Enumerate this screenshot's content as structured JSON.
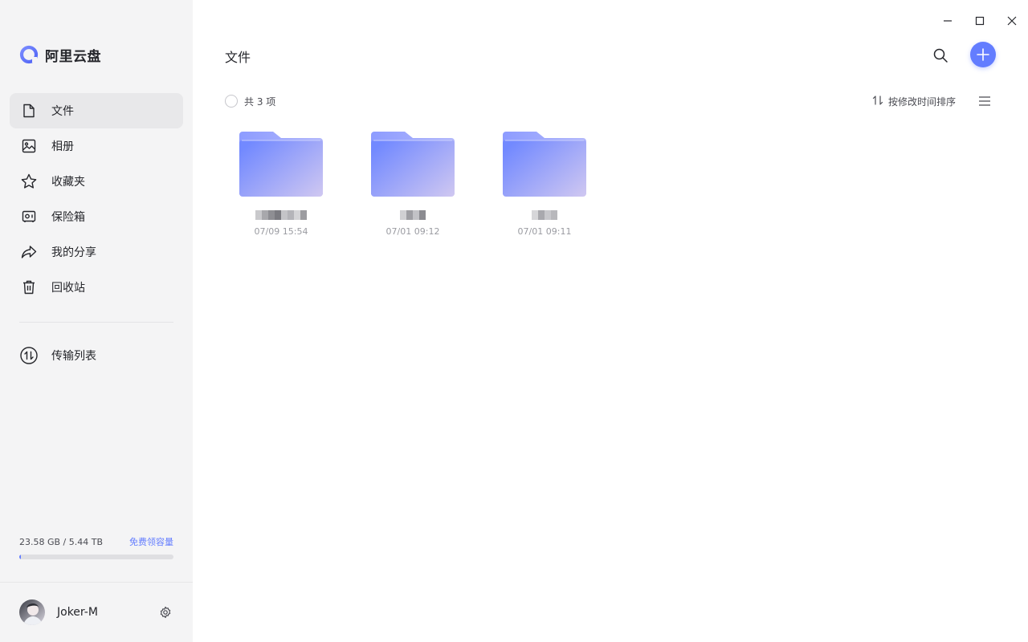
{
  "app": {
    "brand_name": "阿里云盘",
    "accent_color": "#637dff"
  },
  "sidebar": {
    "items": [
      {
        "label": "文件",
        "icon": "file-icon",
        "active": true
      },
      {
        "label": "相册",
        "icon": "photo-album-icon",
        "active": false
      },
      {
        "label": "收藏夹",
        "icon": "star-icon",
        "active": false
      },
      {
        "label": "保险箱",
        "icon": "safe-icon",
        "active": false
      },
      {
        "label": "我的分享",
        "icon": "share-icon",
        "active": false
      },
      {
        "label": "回收站",
        "icon": "trash-icon",
        "active": false
      }
    ],
    "transfer": {
      "label": "传输列表",
      "icon": "transfer-icon"
    },
    "storage": {
      "usage_text": "23.58 GB / 5.44 TB",
      "upgrade_link": "免费领容量",
      "used_fraction": 0.004
    },
    "user": {
      "name": "Joker-M",
      "settings_icon": "settings-icon"
    }
  },
  "main": {
    "title": "文件",
    "toolbar": {
      "count_text": "共 3 项",
      "sort_label": "按修改时间排序",
      "sort_icon": "sort-icon",
      "view_icon": "list-view-icon"
    },
    "files": [
      {
        "type": "folder",
        "name_obscured": true,
        "date": "07/09 15:54"
      },
      {
        "type": "folder",
        "name_obscured": true,
        "date": "07/01 09:12"
      },
      {
        "type": "folder",
        "name_obscured": true,
        "date": "07/01 09:11"
      }
    ]
  },
  "window_controls": [
    "minimize-icon",
    "maximize-icon",
    "close-icon"
  ]
}
